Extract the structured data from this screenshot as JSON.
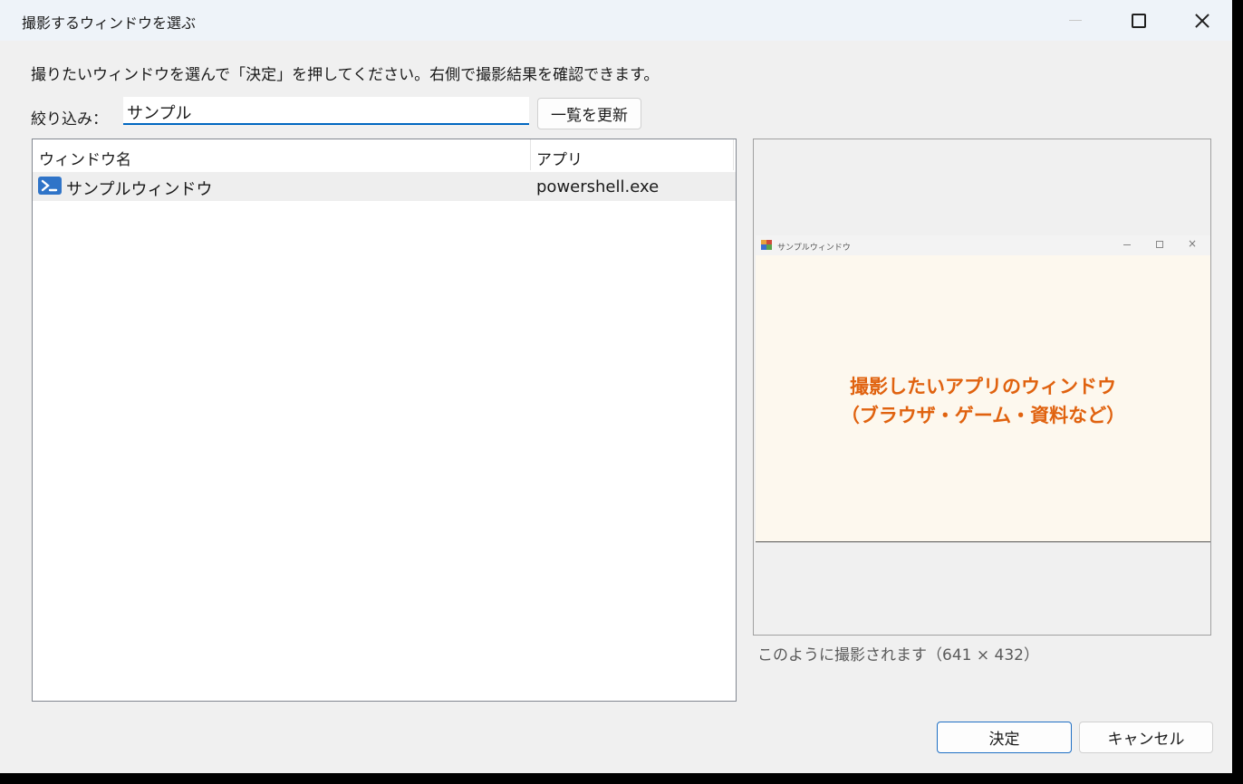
{
  "window": {
    "title": "撮影するウィンドウを選ぶ"
  },
  "instruction": "撮りたいウィンドウを選んで「決定」を押してください。右側で撮影結果を確認できます。",
  "filter": {
    "label": "絞り込み：",
    "value": "サンプル",
    "refresh_label": "一覧を更新"
  },
  "list": {
    "columns": [
      "ウィンドウ名",
      "アプリ"
    ],
    "rows": [
      {
        "name": "サンプルウィンドウ",
        "app": "powershell.exe",
        "icon": "powershell-icon"
      }
    ]
  },
  "preview": {
    "window_title": "サンプルウィンドウ",
    "content_line1": "撮影したいアプリのウィンドウ",
    "content_line2": "（ブラウザ・ゲーム・資料など）",
    "caption": "このように撮影されます（641 × 432）"
  },
  "buttons": {
    "ok": "決定",
    "cancel": "キャンセル"
  },
  "colors": {
    "accent": "#0067c0",
    "preview_text": "#e0620f",
    "preview_bg": "#fdf8ee"
  }
}
